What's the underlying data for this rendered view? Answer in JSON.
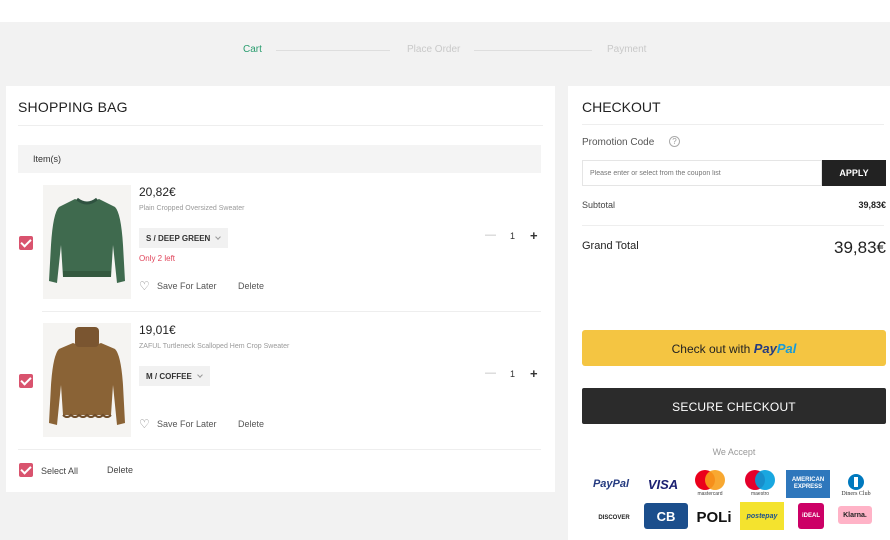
{
  "steps": [
    "Cart",
    "Place Order",
    "Payment"
  ],
  "bag": {
    "title": "SHOPPING BAG",
    "items_header": "Item(s)",
    "select_all": "Select All",
    "delete": "Delete",
    "items": [
      {
        "price": "20,82€",
        "name": "Plain Cropped Oversized Sweater",
        "variant": "S / DEEP GREEN",
        "stock": "Only 2 left",
        "save": "Save For Later",
        "delete": "Delete",
        "qty": "1",
        "color": "#3f6a4e"
      },
      {
        "price": "19,01€",
        "name": "ZAFUL Turtleneck Scalloped Hem Crop Sweater",
        "variant": "M / COFFEE",
        "stock": "",
        "save": "Save For Later",
        "delete": "Delete",
        "qty": "1",
        "color": "#8a6336"
      }
    ]
  },
  "checkout": {
    "title": "CHECKOUT",
    "promo_label": "Promotion Code",
    "coupon_placeholder": "Please enter or select from the coupon list",
    "apply": "APPLY",
    "subtotal_label": "Subtotal",
    "subtotal_value": "39,83€",
    "grand_total_label": "Grand Total",
    "grand_total_value": "39,83€",
    "paypal_prefix": "Check out with",
    "paypal_brand_a": "Pay",
    "paypal_brand_b": "Pal",
    "secure_checkout": "SECURE CHECKOUT",
    "we_accept": "We Accept"
  },
  "payment_methods": {
    "paypal": "PayPal",
    "visa": "VISA",
    "mastercard": "mastercard",
    "maestro": "maestro",
    "amex_a": "AMERICAN",
    "amex_b": "EXPRESS",
    "diners": "Diners Club",
    "discover": "DISCOVER",
    "cb": "CB",
    "poli": "POLi",
    "postepay": "postepay",
    "ideal": "iDEAL",
    "klarna": "Klarna."
  },
  "colors": {
    "accent_green": "#2a9d6f",
    "checkbox_pink": "#d9536e",
    "paypal_yellow": "#f4c542",
    "dark_button": "#2b2b2b"
  }
}
